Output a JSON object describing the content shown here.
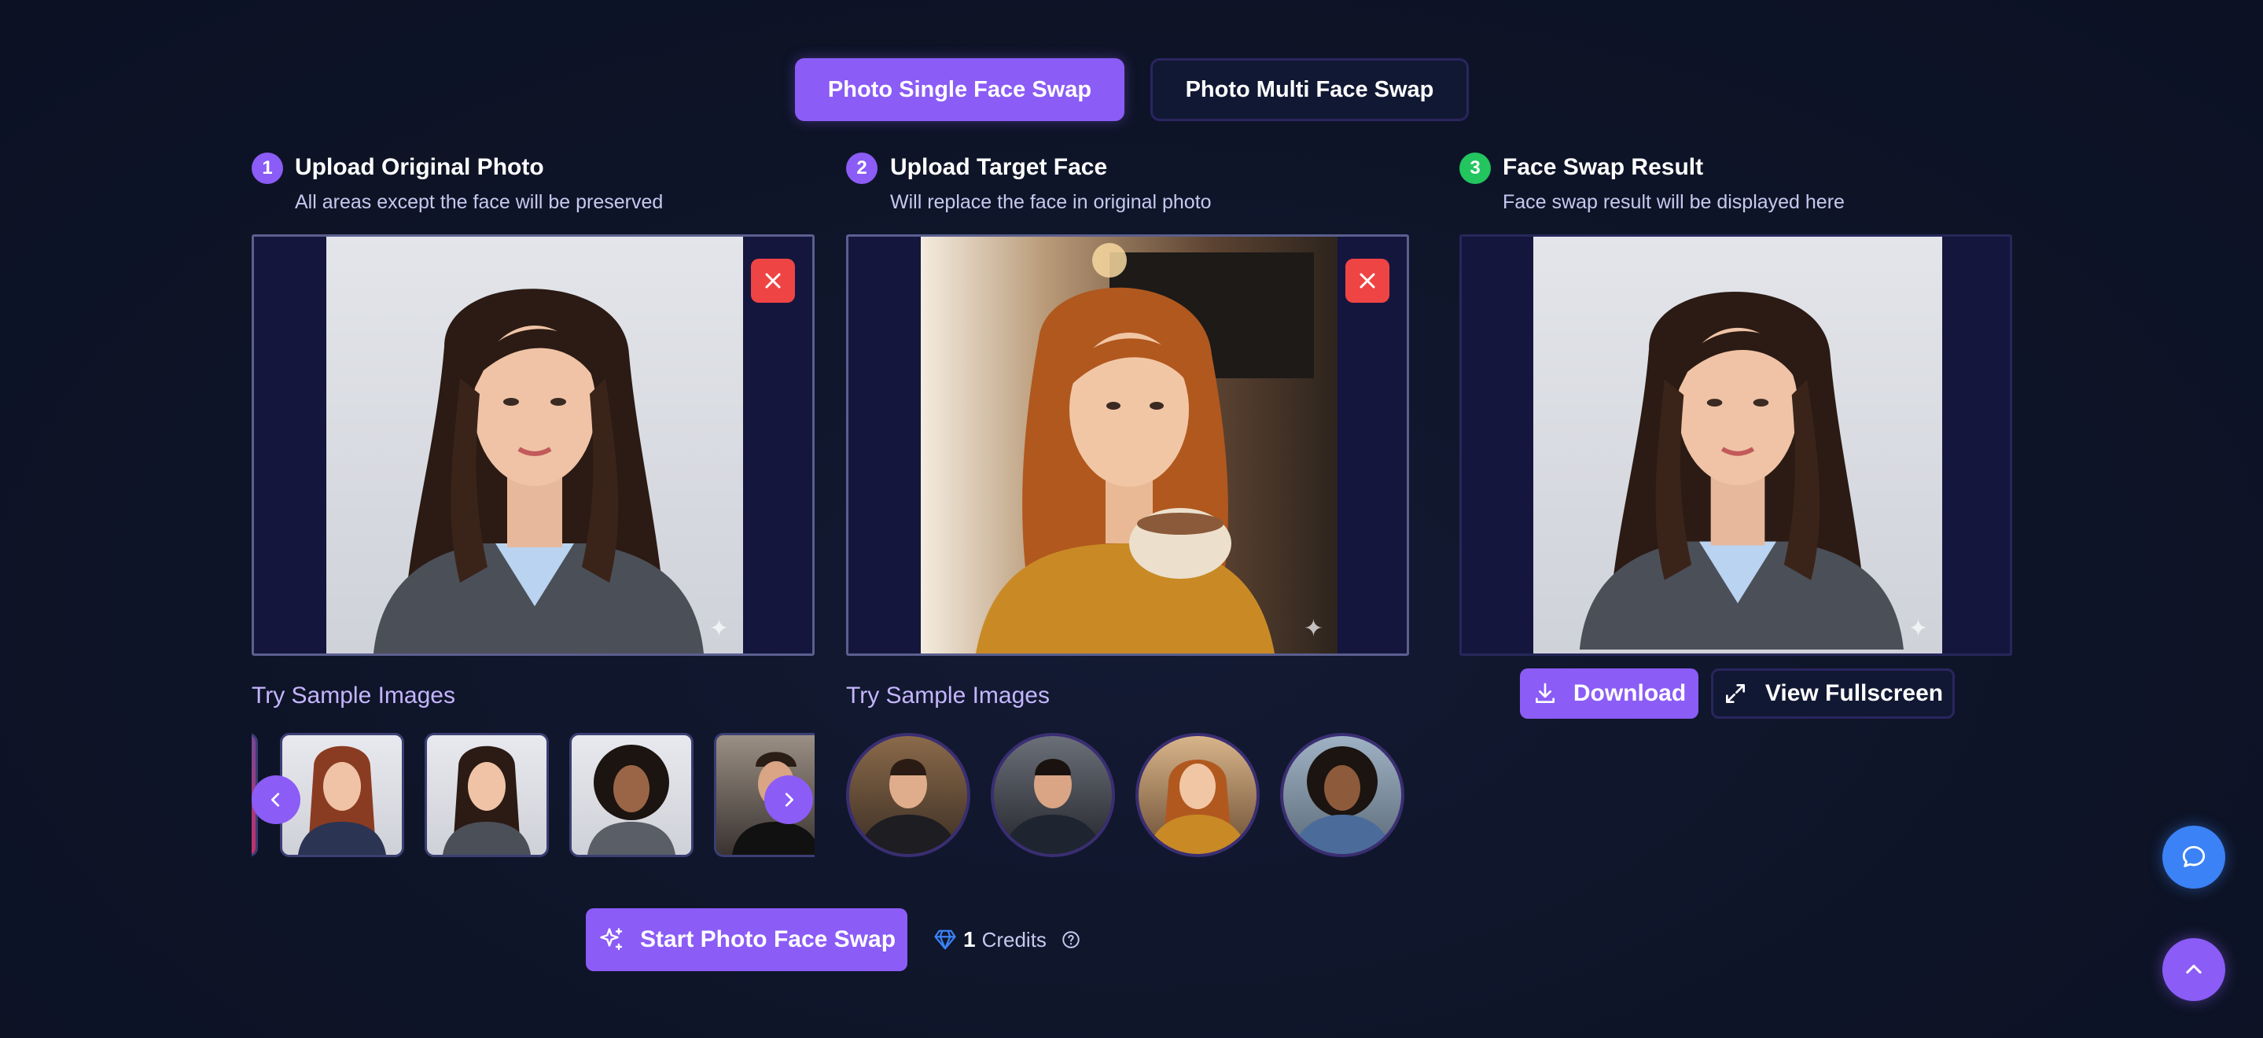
{
  "tabs": {
    "single": "Photo Single Face Swap",
    "multi": "Photo Multi Face Swap"
  },
  "steps": [
    {
      "number": "1",
      "title": "Upload Original Photo",
      "subtitle": "All areas except the face will be preserved"
    },
    {
      "number": "2",
      "title": "Upload Target Face",
      "subtitle": "Will replace the face in original photo"
    },
    {
      "number": "3",
      "title": "Face Swap Result",
      "subtitle": "Face swap result will be displayed here"
    }
  ],
  "samples": {
    "label_original": "Try Sample Images",
    "label_target": "Try Sample Images"
  },
  "result_actions": {
    "download": "Download",
    "fullscreen": "View Fullscreen"
  },
  "start": {
    "label": "Start Photo Face Swap",
    "credits_value": "1",
    "credits_label": "Credits"
  },
  "colors": {
    "accent": "#8b5cf6",
    "close_red": "#ef4444",
    "step3_green": "#22c55e",
    "chat_blue": "#3b82f6",
    "background": "#0f1629"
  }
}
